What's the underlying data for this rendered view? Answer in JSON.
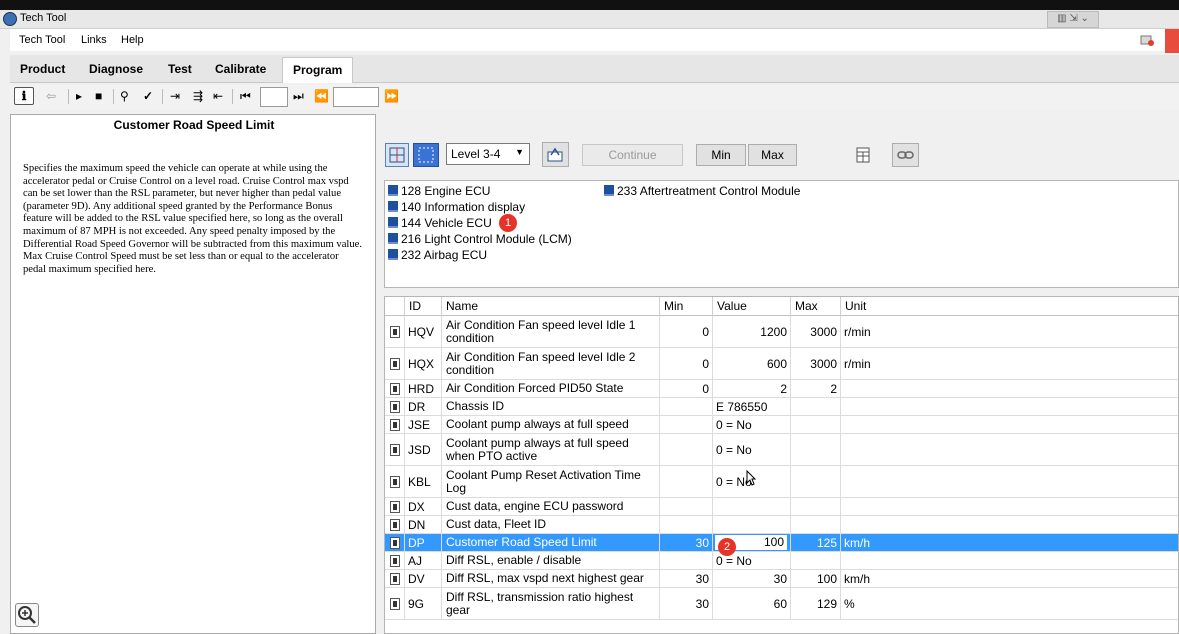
{
  "window": {
    "title": "Tech Tool"
  },
  "menu": [
    "Tech Tool",
    "Links",
    "Help"
  ],
  "tabs": [
    {
      "label": "Product"
    },
    {
      "label": "Diagnose"
    },
    {
      "label": "Test"
    },
    {
      "label": "Calibrate"
    },
    {
      "label": "Program",
      "active": true
    }
  ],
  "description": {
    "title": "Customer Road Speed Limit",
    "body": "Specifies the maximum speed the vehicle can operate at while using the accelerator pedal or Cruise Control on a level road. Cruise Control max vspd can be set lower than the RSL parameter, but never higher than pedal value (parameter 9D). Any additional speed granted by the Performance Bonus feature will be added to the RSL value specified here, so long as the overall maximum of 87 MPH is not exceeded. Any speed penalty imposed by the Differential Road Speed Governor will be subtracted from this maximum value. Max Cruise Control Speed must be set less than or equal to the accelerator pedal maximum specified here."
  },
  "controls": {
    "level_select": "Level 3-4",
    "continue_label": "Continue",
    "min_label": "Min",
    "max_label": "Max"
  },
  "ecus": [
    {
      "id": "128",
      "label": "Engine ECU"
    },
    {
      "id": "140",
      "label": "Information display"
    },
    {
      "id": "144",
      "label": "Vehicle ECU"
    },
    {
      "id": "216",
      "label": "Light Control Module (LCM)"
    },
    {
      "id": "232",
      "label": "Airbag ECU"
    },
    {
      "id": "233",
      "label": "Aftertreatment Control Module"
    }
  ],
  "markers": [
    "1",
    "2"
  ],
  "table": {
    "columns": [
      "ID",
      "Name",
      "Min",
      "Value",
      "Max",
      "Unit"
    ],
    "rows": [
      {
        "id": "HQV",
        "name": "Air Condition Fan speed level Idle 1 condition",
        "min": "0",
        "value": "1200",
        "max": "3000",
        "unit": "r/min"
      },
      {
        "id": "HQX",
        "name": "Air Condition Fan speed level Idle 2 condition",
        "min": "0",
        "value": "600",
        "max": "3000",
        "unit": "r/min"
      },
      {
        "id": "HRD",
        "name": "Air Condition Forced PID50 State",
        "min": "0",
        "value": "2",
        "max": "2",
        "unit": ""
      },
      {
        "id": "DR",
        "name": "Chassis ID",
        "min": "",
        "value": "E    786550",
        "max": "",
        "unit": ""
      },
      {
        "id": "JSE",
        "name": "Coolant pump always at full speed",
        "min": "",
        "value": "0 = No",
        "max": "",
        "unit": ""
      },
      {
        "id": "JSD",
        "name": "Coolant pump always at full speed when PTO active",
        "min": "",
        "value": "0 = No",
        "max": "",
        "unit": ""
      },
      {
        "id": "KBL",
        "name": "Coolant Pump Reset Activation Time Log",
        "min": "",
        "value": "0 = No",
        "max": "",
        "unit": ""
      },
      {
        "id": "DX",
        "name": "Cust data, engine ECU password",
        "min": "",
        "value": "",
        "max": "",
        "unit": ""
      },
      {
        "id": "DN",
        "name": "Cust data, Fleet ID",
        "min": "",
        "value": "",
        "max": "",
        "unit": ""
      },
      {
        "id": "DP",
        "name": "Customer Road Speed Limit",
        "min": "30",
        "value": "100",
        "max": "125",
        "unit": "km/h",
        "selected": true
      },
      {
        "id": "AJ",
        "name": "Diff RSL, enable / disable",
        "min": "",
        "value": "0 = No",
        "max": "",
        "unit": ""
      },
      {
        "id": "DV",
        "name": "Diff RSL, max vspd next highest gear",
        "min": "30",
        "value": "30",
        "max": "100",
        "unit": "km/h"
      },
      {
        "id": "9G",
        "name": "Diff RSL, transmission ratio highest gear",
        "min": "30",
        "value": "60",
        "max": "129",
        "unit": "%"
      }
    ]
  }
}
